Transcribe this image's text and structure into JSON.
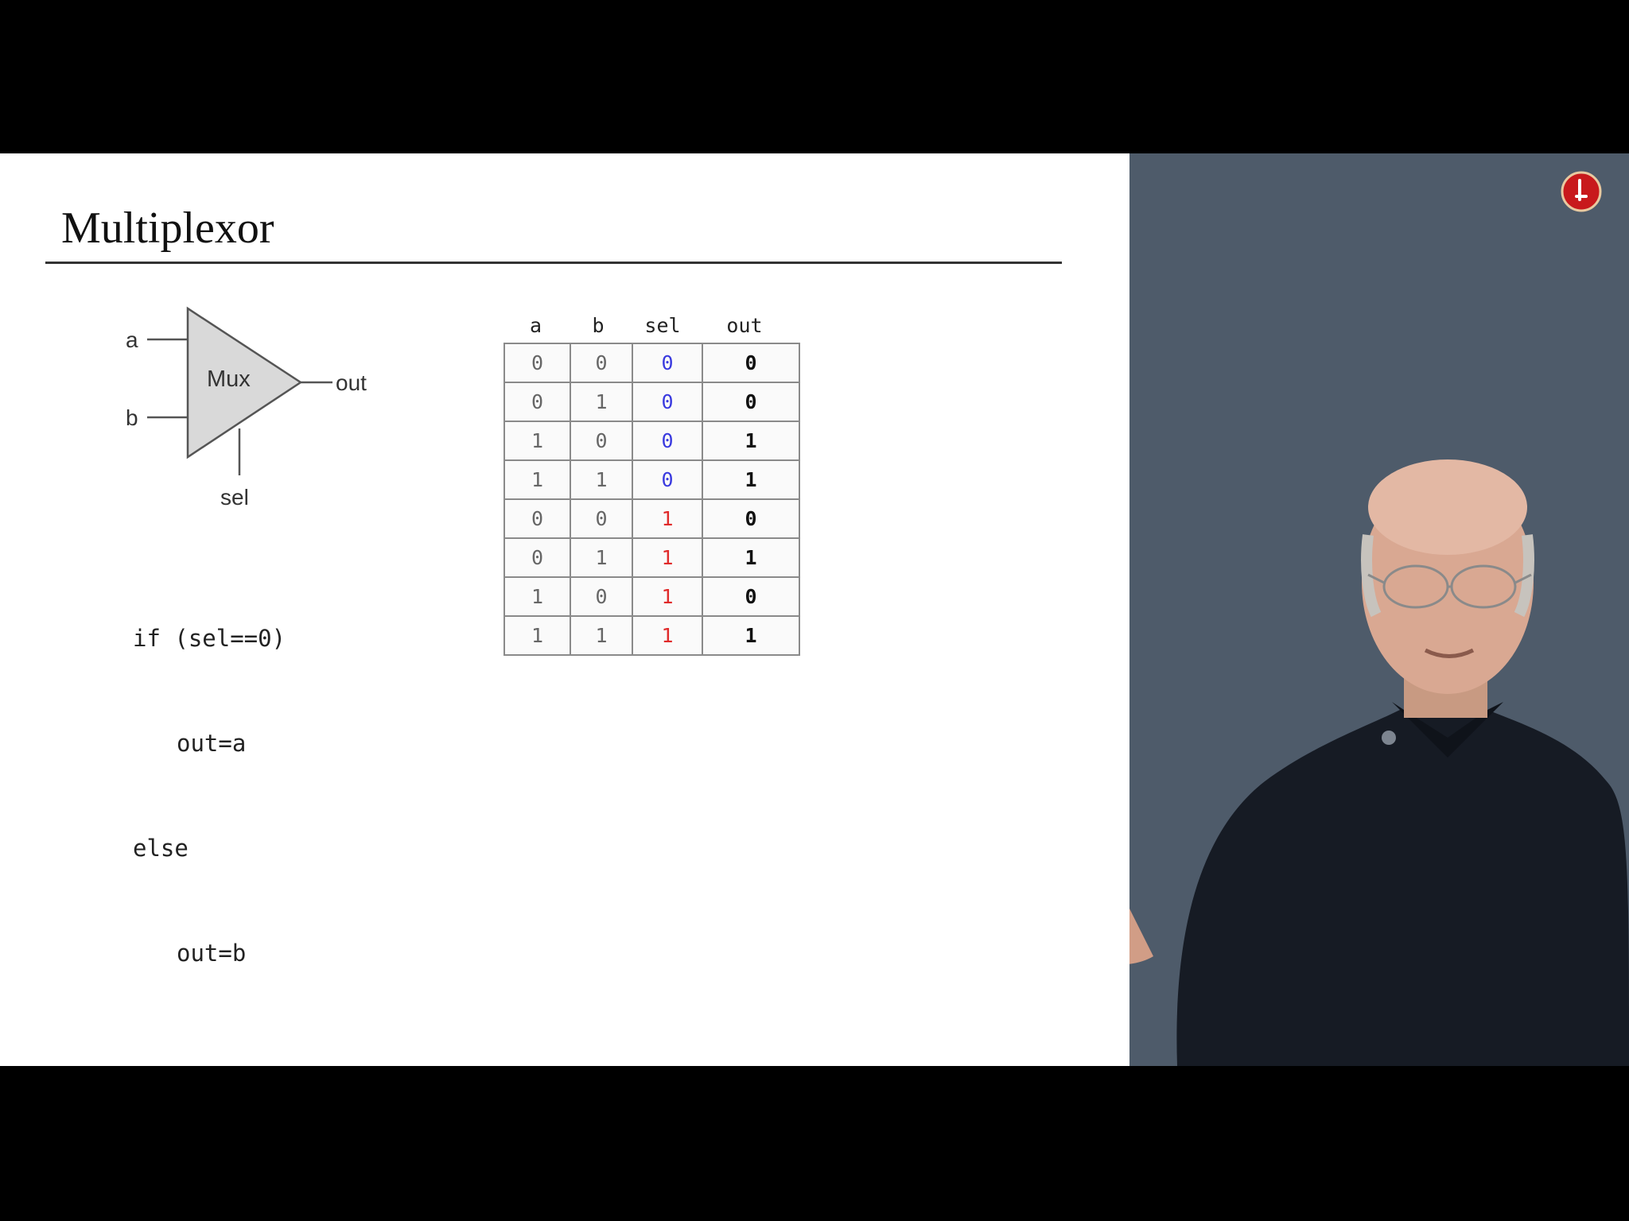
{
  "slide": {
    "title": "Multiplexor",
    "mux": {
      "label": "Mux",
      "input_a": "a",
      "input_b": "b",
      "output": "out",
      "select": "sel"
    },
    "code": {
      "line1": "if (sel==0)",
      "line2": "out=a",
      "line3": "else",
      "line4": "out=b"
    },
    "truth_table": {
      "headers": [
        "a",
        "b",
        "sel",
        "out"
      ],
      "rows": [
        [
          "0",
          "0",
          "0",
          "0"
        ],
        [
          "0",
          "1",
          "0",
          "0"
        ],
        [
          "1",
          "0",
          "0",
          "1"
        ],
        [
          "1",
          "1",
          "0",
          "1"
        ],
        [
          "0",
          "0",
          "1",
          "0"
        ],
        [
          "0",
          "1",
          "1",
          "1"
        ],
        [
          "1",
          "0",
          "1",
          "0"
        ],
        [
          "1",
          "1",
          "1",
          "1"
        ]
      ]
    }
  },
  "colors": {
    "sel_zero": "#3a3adf",
    "sel_one": "#e02a2a",
    "presenter_background": "#4e5b6a",
    "logo_red": "#c8191c"
  },
  "presenter": {
    "logo_icon": "channel-logo-icon"
  }
}
